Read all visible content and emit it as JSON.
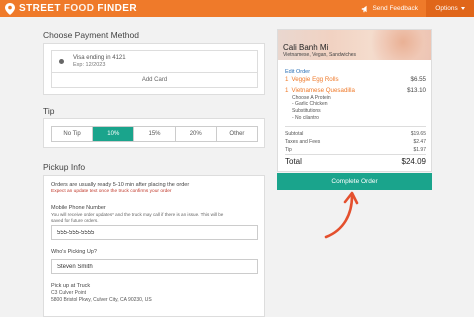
{
  "header": {
    "logo_street": "STREET",
    "logo_food": "FOOD",
    "logo_finder": "FINDER",
    "feedback_label": "Send Feedback",
    "options_label": "Options"
  },
  "payment": {
    "title": "Choose Payment Method",
    "card_label": "Visa ending in 4121",
    "card_exp": "Exp: 12/2023",
    "add_card_label": "Add Card"
  },
  "tip": {
    "title": "Tip",
    "options": [
      "No Tip",
      "10%",
      "15%",
      "20%",
      "Other"
    ],
    "selected": "10%"
  },
  "pickup": {
    "title": "Pickup Info",
    "note": "Orders are usually ready 5-10 min after placing the order",
    "warning": "Expect an update text once the truck confirms your order",
    "phone_label": "Mobile Phone Number",
    "phone_help": "You will receive order updates* and the truck may call if there is an issue. This will be saved for future orders.",
    "phone_value": "555-555-5555",
    "name_label": "Who's Picking Up?",
    "name_value": "Steven Smith",
    "location_label": "Pick up at Truck",
    "location_name": "C3 Culver Point",
    "location_address": "5800 Bristol Pkwy, Culver City, CA 90230, US"
  },
  "order": {
    "truck_name": "Cali Banh Mi",
    "cuisine": "Vietnamese, Vegan, Sandwiches",
    "edit_label": "Edit Order",
    "items": [
      {
        "qty": "1",
        "name": "Veggie Egg Rolls",
        "price": "$6.55"
      },
      {
        "qty": "1",
        "name": "Vietnamese Quesadilla",
        "price": "$13.10"
      }
    ],
    "mods": {
      "choose_protein": "Choose A Protein",
      "protein": "- Garlic Chicken",
      "substitutions": "Substitutions",
      "sub_value": "- No cilantro"
    },
    "subtotal_label": "Subtotal",
    "subtotal": "$19.65",
    "taxes_label": "Taxes and Fees",
    "taxes": "$2.47",
    "tip_label": "Tip",
    "tip": "$1.97",
    "total_label": "Total",
    "total": "$24.09",
    "complete_label": "Complete Order"
  },
  "colors": {
    "brand_orange": "#ef7a2a",
    "teal": "#1aa48c",
    "arrow_red": "#e4502e"
  }
}
